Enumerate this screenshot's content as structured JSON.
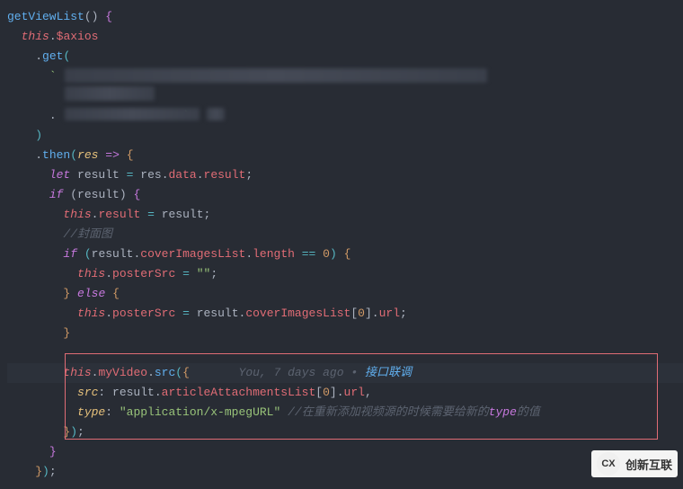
{
  "code": {
    "l1_fn": "getViewList",
    "l2_this": "this",
    "l2_axios": "$axios",
    "l3_get": "get",
    "l6_then": "then",
    "l6_res": "res",
    "l7_let": "let",
    "l7_result": "result",
    "l7_res": "res",
    "l7_data": "data",
    "l7_result2": "result",
    "l8_if": "if",
    "l8_result": "result",
    "l9_this": "this",
    "l9_result": "result",
    "l9_result2": "result",
    "l10_comment": "//封面图",
    "l11_if": "if",
    "l11_result": "result",
    "l11_cil": "coverImagesList",
    "l11_len": "length",
    "l11_zero": "0",
    "l12_this": "this",
    "l12_poster": "posterSrc",
    "l12_empty": "\"\"",
    "l13_else": "else",
    "l14_this": "this",
    "l14_poster": "posterSrc",
    "l14_result": "result",
    "l14_cil": "coverImagesList",
    "l14_zero": "0",
    "l14_url": "url",
    "l17_this": "this",
    "l17_myVideo": "myVideo",
    "l17_src": "src",
    "gitlens_author": "You, 7 days ago",
    "gitlens_sep": " • ",
    "gitlens_msg": "接口联调",
    "l18_src": "src",
    "l18_result": "result",
    "l18_aal": "articleAttachmentsList",
    "l18_zero": "0",
    "l18_url": "url",
    "l19_type": "type",
    "l19_str": "\"application/x-mpegURL\"",
    "l19_comment_a": "//在重新添加视频源的时候需要给新的",
    "l19_comment_type": "type",
    "l19_comment_b": "的值"
  },
  "watermark": {
    "icon": "CX",
    "text": "创新互联"
  }
}
